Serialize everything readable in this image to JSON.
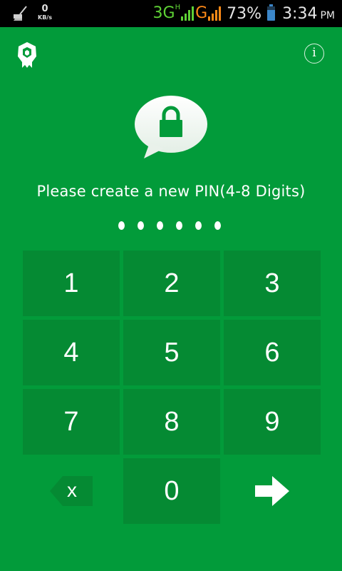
{
  "status_bar": {
    "speed_value": "0",
    "speed_unit": "KB/s",
    "network_1": "3G",
    "network_1_sub": "H",
    "network_2": "G",
    "battery_percent": "73%",
    "time": "3:34",
    "ampm": "PM",
    "colors": {
      "network_1": "#5ed135",
      "network_2": "#ff8a17",
      "battery": "#3b86c9"
    }
  },
  "header": {
    "logo_icon": "shield-logo-icon",
    "info_label": "i"
  },
  "lock_icon": "lock-speech-bubble-icon",
  "prompt": "Please create a new PIN(4-8 Digits)",
  "pin": {
    "entered_digits": 6
  },
  "keypad": {
    "keys": [
      {
        "label": "1"
      },
      {
        "label": "2"
      },
      {
        "label": "3"
      },
      {
        "label": "4"
      },
      {
        "label": "5"
      },
      {
        "label": "6"
      },
      {
        "label": "7"
      },
      {
        "label": "8"
      },
      {
        "label": "9"
      },
      {
        "label": "x"
      },
      {
        "label": "0"
      },
      {
        "label": ""
      }
    ],
    "backspace_icon": "backspace-icon",
    "enter_icon": "arrow-right-icon"
  },
  "colors": {
    "background": "#029b3a",
    "key_background": "#058a33"
  }
}
